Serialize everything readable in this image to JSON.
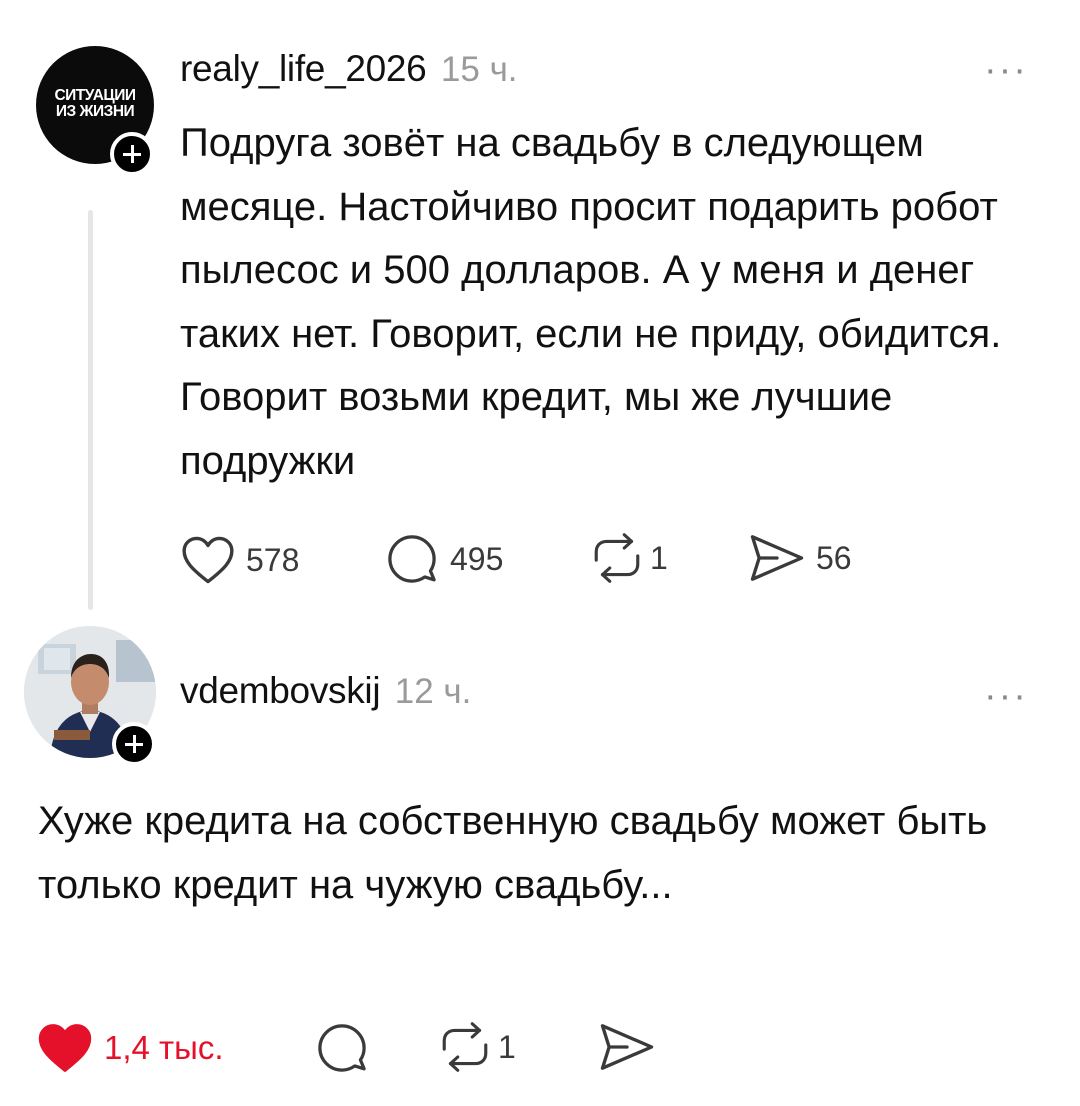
{
  "post": {
    "avatar_text": [
      "СИТУАЦИИ",
      "ИЗ ЖИЗНИ"
    ],
    "username": "realy_life_2026",
    "time": "15 ч.",
    "more": "···",
    "text": "Подруга зовёт на свадьбу в следующем месяце. Настойчиво просит подарить робот пылесос и 500 долларов. А у меня и денег таких нет. Говорит, если не приду, обидится. Говорит возьми кредит, мы же лучшие подружки",
    "actions": {
      "likes": "578",
      "comments": "495",
      "reposts": "1",
      "shares": "56"
    }
  },
  "reply": {
    "username": "vdembovskij",
    "time": "12 ч.",
    "more": "···",
    "text": "Хуже кредита на собственную свадьбу может быть только кредит на чужую свадьбу...",
    "actions": {
      "likes": "1,4 тыс.",
      "reposts": "1"
    }
  },
  "colors": {
    "like_active": "#e5102a",
    "icon_gray": "#3a3a3a",
    "muted": "#9a9a9a"
  }
}
